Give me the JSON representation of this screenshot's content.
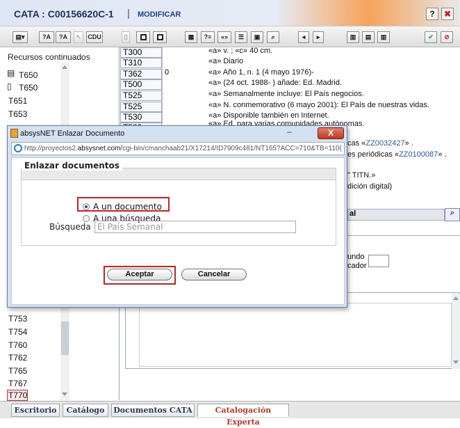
{
  "app": {
    "title": "CATA : C00156620C-1",
    "separator": "|",
    "modify_label": "MODIFICAR",
    "help_label": "?",
    "close_label": "✖"
  },
  "toolbar": {
    "b2": "?A",
    "b3": "?A",
    "b5": "CDU"
  },
  "left_panel": {
    "header": "Recursos continuados",
    "items_top": [
      "T650",
      "T650",
      "T651",
      "T653"
    ],
    "items_bottom": [
      "T753",
      "T754",
      "T760",
      "T762",
      "T765",
      "T767",
      "T770"
    ]
  },
  "records": [
    {
      "tag": "T300",
      "ind": "",
      "text": "«a» v. ; «c» 40 cm."
    },
    {
      "tag": "T310",
      "ind": "",
      "text": "«a» Diario"
    },
    {
      "tag": "T362",
      "ind": "0",
      "text": "«a» Año 1, n. 1 (4 mayo 1976)-"
    },
    {
      "tag": "T500",
      "ind": "",
      "text": "«a» (24 oct. 1988- ) añade: Ed. Madrid."
    },
    {
      "tag": "T525",
      "ind": "",
      "text": "«a» Semanalmente incluye: El País negocios."
    },
    {
      "tag": "T525",
      "ind": "",
      "text": "«a» N. conmemorativo (6 mayo 2001): El País de nuestras vidas."
    },
    {
      "tag": "T530",
      "ind": "",
      "text": "«a» Disponible también en Internet."
    },
    {
      "tag": "T580",
      "ind": "",
      "text": "«a» Ed. para varias comunidades autónomas."
    }
  ],
  "background_fragments": {
    "line1_prefix": "cas «",
    "line1_link": "ZZ0032427",
    "line1_suffix": "» .",
    "line2_prefix": "es periódicas «",
    "line2_link": "ZZ0100087",
    "line2_suffix": "» .",
    "line3": "\" TITN.»",
    "line4": "dición digital)",
    "section_label": "al",
    "mundo": "undo",
    "cador": "cador"
  },
  "dialog": {
    "title": "absysNET Enlazar Documento",
    "url_prefix": "http://proyectos2.",
    "url_host": "absysnet.com",
    "url_rest": "/cgi-bin/cmanchaab21/X17214/ID7909c481/NT165?ACC=710&TB=110(",
    "close_label": "X",
    "minimize_label": "–",
    "legend": "Enlazar documentos",
    "radio_options": [
      "A un documento",
      "A una búsqueda"
    ],
    "selected": 0,
    "search_label": "Búsqueda",
    "search_value": "El País Semanal",
    "accept_label": "Aceptar",
    "cancel_label": "Cancelar"
  },
  "tabs": [
    {
      "label": "Escritorio",
      "active": false
    },
    {
      "label": "Catálogo",
      "active": false
    },
    {
      "label": "Documentos CATA",
      "active": false
    },
    {
      "label": "Catalogación Experta",
      "active": true
    }
  ],
  "colors": {
    "highlight": "#e11b1b",
    "link": "#2a57a8",
    "active_tab": "#c0392b"
  }
}
